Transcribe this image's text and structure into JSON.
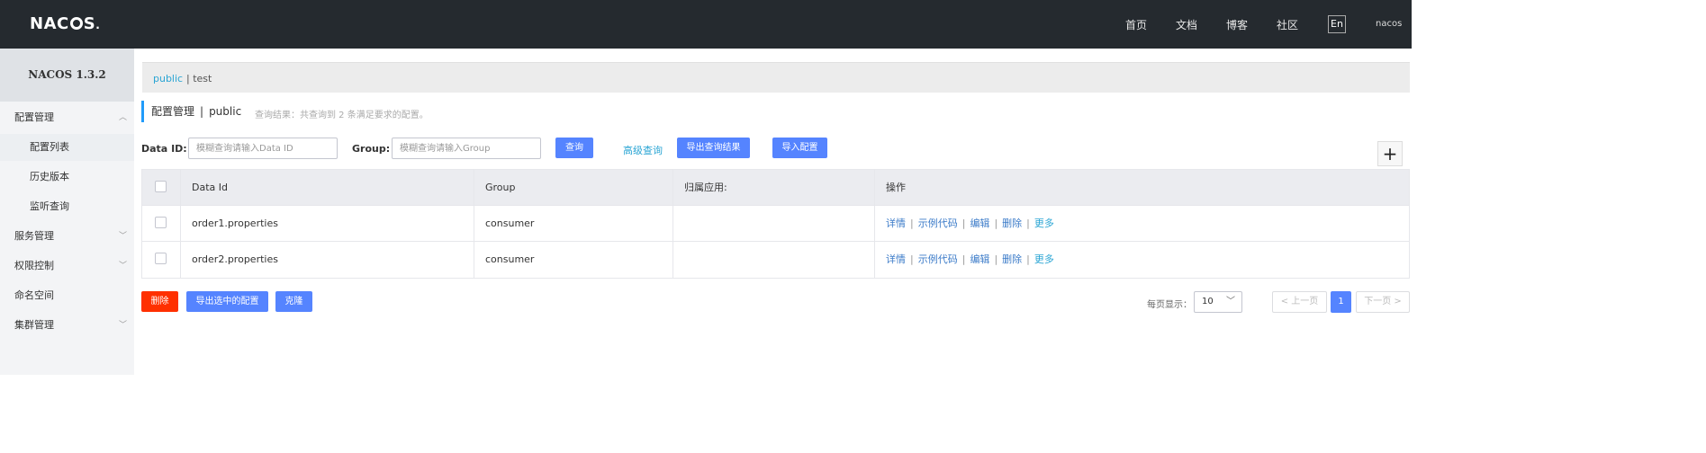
{
  "app": {
    "logo": "NACOS.",
    "version_title": "NACOS 1.3.2"
  },
  "topnav": {
    "home": "首页",
    "docs": "文档",
    "blog": "博客",
    "community": "社区",
    "lang": "En",
    "user": "nacos"
  },
  "sidebar": {
    "items": [
      {
        "label": "配置管理",
        "chevron": "up"
      },
      {
        "label": "配置列表"
      },
      {
        "label": "历史版本"
      },
      {
        "label": "监听查询"
      },
      {
        "label": "服务管理",
        "chevron": "down"
      },
      {
        "label": "权限控制",
        "chevron": "down"
      },
      {
        "label": "命名空间"
      },
      {
        "label": "集群管理",
        "chevron": "down"
      }
    ]
  },
  "namespace": {
    "active": "public",
    "other": "| test"
  },
  "header": {
    "title": "配置管理",
    "sep": "|",
    "namespace": "public",
    "hint": "查询结果：共查询到 2 条满足要求的配置。"
  },
  "search": {
    "dataid_label": "Data ID:",
    "dataid_placeholder": "模糊查询请输入Data ID",
    "group_label": "Group:",
    "group_placeholder": "模糊查询请输入Group",
    "query_btn": "查询",
    "advanced": "高级查询",
    "export_btn": "导出查询结果",
    "import_btn": "导入配置"
  },
  "table": {
    "columns": [
      "Data Id",
      "Group",
      "归属应用:",
      "操作"
    ],
    "rows": [
      {
        "data_id": "order1.properties",
        "group": "consumer",
        "app": ""
      },
      {
        "data_id": "order2.properties",
        "group": "consumer",
        "app": ""
      }
    ],
    "ops": {
      "detail": "详情",
      "sample": "示例代码",
      "edit": "编辑",
      "delete": "删除",
      "more": "更多"
    },
    "pipe": "|"
  },
  "bulk": {
    "delete": "删除",
    "export_selected": "导出选中的配置",
    "clone": "克隆"
  },
  "pagination": {
    "per_page_label": "每页显示：",
    "per_page": "10",
    "prev": "< 上一页",
    "current": "1",
    "next": "下一页 >"
  },
  "colors": {
    "topbar": "#252a2f",
    "primary": "#5584ff",
    "danger": "#ff3000",
    "link": "#3d7cc9",
    "accent": "#2aa5d4"
  }
}
